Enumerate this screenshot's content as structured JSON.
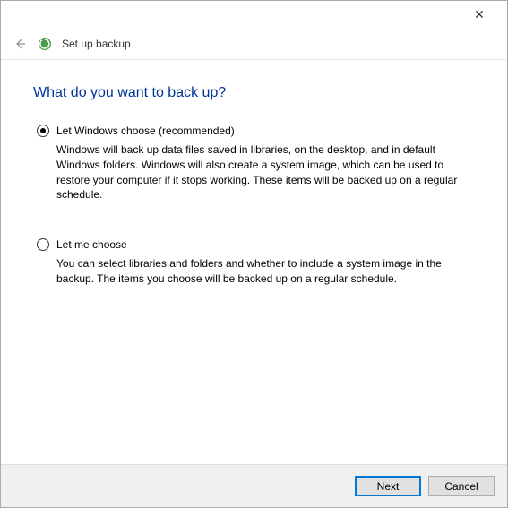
{
  "titlebar": {
    "close_glyph": "✕"
  },
  "header": {
    "back_glyph": "←",
    "title": "Set up backup"
  },
  "content": {
    "heading": "What do you want to back up?",
    "options": [
      {
        "label": "Let Windows choose (recommended)",
        "description": "Windows will back up data files saved in libraries, on the desktop, and in default Windows folders. Windows will also create a system image, which can be used to restore your computer if it stops working. These items will be backed up on a regular schedule.",
        "selected": true
      },
      {
        "label": "Let me choose",
        "description": "You can select libraries and folders and whether to include a system image in the backup. The items you choose will be backed up on a regular schedule.",
        "selected": false
      }
    ]
  },
  "footer": {
    "next_label": "Next",
    "cancel_label": "Cancel"
  }
}
